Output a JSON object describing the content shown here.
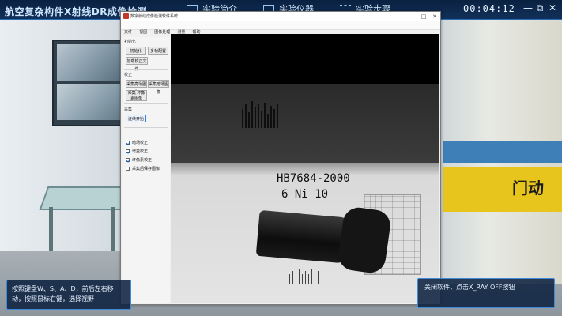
{
  "app": {
    "title": "航空复杂构件X射线DR成像检测",
    "timer": "00:04:12"
  },
  "nav": [
    {
      "label": "实验简介",
      "icon": "document-icon"
    },
    {
      "label": "实验仪器",
      "icon": "monitor-icon"
    },
    {
      "label": "实验步骤",
      "icon": "list-icon"
    }
  ],
  "window_controls": {
    "minimize": "—",
    "restore": "⧉",
    "close": "✕"
  },
  "software": {
    "title": "数字射线成像检测软件系统",
    "controls": {
      "minimize": "—",
      "maximize": "□",
      "close": "✕"
    },
    "menu": [
      "文件",
      "视图",
      "图像处理",
      "测量",
      "帮助"
    ],
    "tabs": [
      "设定",
      "采集"
    ],
    "left_panel": {
      "group_init": "初始化",
      "btn_init": "初始化",
      "btn_multi": "多帧配置",
      "btn_calib": "加载校正文件",
      "group_calib": "校正",
      "btn_bright": "采集亮场图像",
      "btn_dark": "采集暗场图像",
      "btn_defect": "采集 坏像素图像",
      "group_acq": "采集",
      "btn_start": "连续开始",
      "checks": [
        {
          "label": "暗场校正",
          "checked": true
        },
        {
          "label": "增益校正",
          "checked": true
        },
        {
          "label": "坏像素校正",
          "checked": true
        },
        {
          "label": "采集后保存图像",
          "checked": false
        }
      ]
    },
    "image": {
      "label_line1": "HB7684-2000",
      "label_line2": "6 Ni 10"
    }
  },
  "scene": {
    "door_sign": "门动"
  },
  "hints": {
    "left": "按照键盘W、S、A、D，前后左右移动，按照鼠标右键，选择视野",
    "right": "关闭软件，点击X_RAY OFF按钮"
  }
}
